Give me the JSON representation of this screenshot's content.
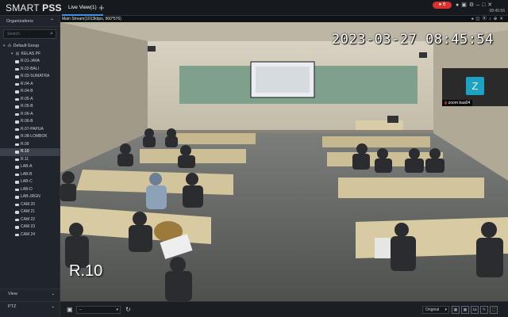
{
  "app": {
    "brand_light": "SMART ",
    "brand_bold": "PSS",
    "active_tab": "Live View(1)",
    "add_tab_icon": "plus-icon",
    "rec_badge": "6",
    "clock": "08:45:56",
    "top_icons": [
      "user-icon",
      "lock-icon",
      "gear-icon",
      "minimize-icon",
      "maximize-icon",
      "close-icon"
    ]
  },
  "sidebar": {
    "organizations_label": "Organizations",
    "search_placeholder": "Search",
    "group_root": "Default Group",
    "group_sub": "KELAS PF",
    "cameras": [
      "R.01-JAVA",
      "R.02-BALI",
      "R.03-SUMATRA",
      "R.04-A",
      "R.04-B",
      "R.05-A",
      "R.05-B",
      "R.06-A",
      "R.06-B",
      "R.07-PAPUA",
      "R.08-LOMBOK",
      "R.09",
      "R.10",
      "R.11",
      "LAB-A",
      "LAB-B",
      "LAB-C",
      "LAB-D",
      "LAB-JRGN",
      "CAM 20",
      "CAM 21",
      "CAM 22",
      "CAM 23",
      "CAM 24"
    ],
    "selected_camera": "R.10",
    "footer_view": "View",
    "footer_ptz": "PTZ"
  },
  "video": {
    "stream_info": "Main Stream(1013kbps, 960*576)",
    "osd_timestamp": "2023-03-27 08:45:54",
    "osd_channel_name": "R.10",
    "zoom_avatar_letter": "Z",
    "zoom_participant": "zoom baa04"
  },
  "bottombar": {
    "stream_select": "--",
    "scale_select": "Original",
    "layout_buttons": [
      "1x1",
      "2x2",
      "16",
      "custom"
    ]
  },
  "colors": {
    "accent": "#3f8fe6",
    "record": "#d9312d",
    "zoom_avatar": "#1ca3c2",
    "sidebar_bg": "#20252b",
    "selected_row": "#3a414a"
  }
}
